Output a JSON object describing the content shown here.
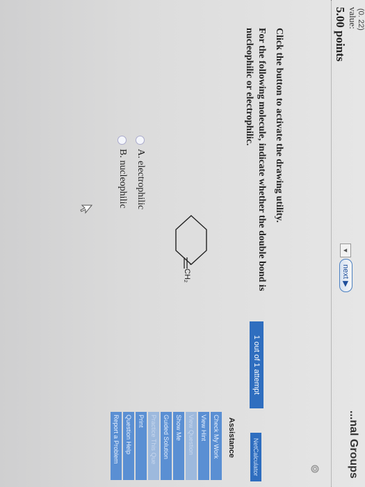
{
  "header": {
    "partial_top_text": "(0. 22)",
    "groups_title": "...nal Groups",
    "next_label": "next ▶"
  },
  "value": {
    "label": "value:",
    "points": "5.00 points"
  },
  "question": {
    "instruction": "Click the button to activate the drawing utility.",
    "text": "For the following molecule, indicate whether the double bond is nucleophilic or electrophilic.",
    "molecule_label": "CH₂",
    "options": [
      {
        "label": "A. electrophilic"
      },
      {
        "label": "B. nucleophilic"
      }
    ]
  },
  "attempt": "1 out of 1 attempt",
  "sidebar": {
    "netcalc": "NetCalculator",
    "assistance_title": "Assistance",
    "buttons": [
      {
        "label": "Check My Work",
        "dim": false
      },
      {
        "label": "View Hint",
        "dim": false
      },
      {
        "label": "View Question",
        "dim": true
      },
      {
        "label": "Show Me",
        "dim": false
      },
      {
        "label": "Guided Solution",
        "dim": false
      },
      {
        "label": "Practice This Que",
        "dim": true
      },
      {
        "label": "Print",
        "dim": false
      },
      {
        "label": "Question Help",
        "dim": false
      },
      {
        "label": "Report a Problem",
        "dim": false
      }
    ]
  },
  "colors": {
    "accent": "#2f6ebf",
    "button": "#5a8fd3",
    "button_dim": "#9db9dd"
  }
}
